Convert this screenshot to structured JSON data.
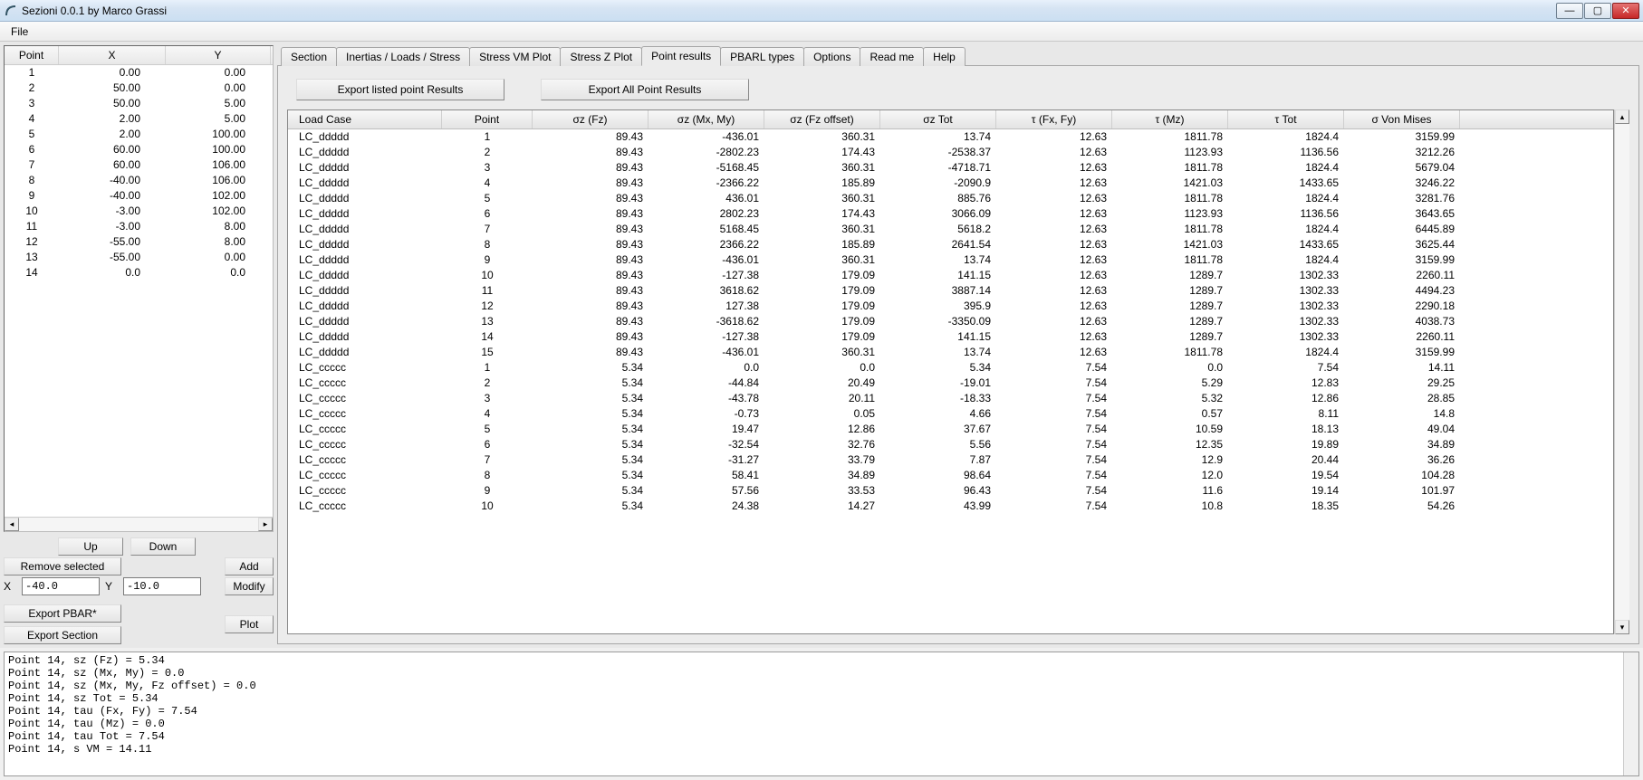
{
  "window": {
    "title": "Sezioni 0.0.1 by Marco Grassi",
    "menu": {
      "file": "File"
    }
  },
  "tabs": {
    "items": [
      "Section",
      "Inertias / Loads / Stress",
      "Stress VM Plot",
      "Stress Z Plot",
      "Point results",
      "PBARL types",
      "Options",
      "Read me",
      "Help"
    ],
    "active": 4
  },
  "left": {
    "headers": {
      "point": "Point",
      "x": "X",
      "y": "Y"
    },
    "rows": [
      {
        "p": "1",
        "x": "0.00",
        "y": "0.00"
      },
      {
        "p": "2",
        "x": "50.00",
        "y": "0.00"
      },
      {
        "p": "3",
        "x": "50.00",
        "y": "5.00"
      },
      {
        "p": "4",
        "x": "2.00",
        "y": "5.00"
      },
      {
        "p": "5",
        "x": "2.00",
        "y": "100.00"
      },
      {
        "p": "6",
        "x": "60.00",
        "y": "100.00"
      },
      {
        "p": "7",
        "x": "60.00",
        "y": "106.00"
      },
      {
        "p": "8",
        "x": "-40.00",
        "y": "106.00"
      },
      {
        "p": "9",
        "x": "-40.00",
        "y": "102.00"
      },
      {
        "p": "10",
        "x": "-3.00",
        "y": "102.00"
      },
      {
        "p": "11",
        "x": "-3.00",
        "y": "8.00"
      },
      {
        "p": "12",
        "x": "-55.00",
        "y": "8.00"
      },
      {
        "p": "13",
        "x": "-55.00",
        "y": "0.00"
      },
      {
        "p": "14",
        "x": "0.0",
        "y": "0.0"
      }
    ],
    "buttons": {
      "up": "Up",
      "down": "Down",
      "remove": "Remove selected",
      "add": "Add",
      "modify": "Modify",
      "pbar": "Export PBAR*",
      "section": "Export Section",
      "plot": "Plot"
    },
    "x_label": "X",
    "y_label": "Y",
    "x_value": "-40.0",
    "y_value": "-10.0"
  },
  "results": {
    "export_listed": "Export listed point Results",
    "export_all": "Export All Point Results",
    "headers": [
      "Load Case",
      "Point",
      "σz (Fz)",
      "σz (Mx, My)",
      "σz (Fz offset)",
      "σz Tot",
      "τ (Fx, Fy)",
      "τ (Mz)",
      "τ Tot",
      "σ Von Mises"
    ],
    "rows": [
      [
        "LC_ddddd",
        "1",
        "89.43",
        "-436.01",
        "360.31",
        "13.74",
        "12.63",
        "1811.78",
        "1824.4",
        "3159.99"
      ],
      [
        "LC_ddddd",
        "2",
        "89.43",
        "-2802.23",
        "174.43",
        "-2538.37",
        "12.63",
        "1123.93",
        "1136.56",
        "3212.26"
      ],
      [
        "LC_ddddd",
        "3",
        "89.43",
        "-5168.45",
        "360.31",
        "-4718.71",
        "12.63",
        "1811.78",
        "1824.4",
        "5679.04"
      ],
      [
        "LC_ddddd",
        "4",
        "89.43",
        "-2366.22",
        "185.89",
        "-2090.9",
        "12.63",
        "1421.03",
        "1433.65",
        "3246.22"
      ],
      [
        "LC_ddddd",
        "5",
        "89.43",
        "436.01",
        "360.31",
        "885.76",
        "12.63",
        "1811.78",
        "1824.4",
        "3281.76"
      ],
      [
        "LC_ddddd",
        "6",
        "89.43",
        "2802.23",
        "174.43",
        "3066.09",
        "12.63",
        "1123.93",
        "1136.56",
        "3643.65"
      ],
      [
        "LC_ddddd",
        "7",
        "89.43",
        "5168.45",
        "360.31",
        "5618.2",
        "12.63",
        "1811.78",
        "1824.4",
        "6445.89"
      ],
      [
        "LC_ddddd",
        "8",
        "89.43",
        "2366.22",
        "185.89",
        "2641.54",
        "12.63",
        "1421.03",
        "1433.65",
        "3625.44"
      ],
      [
        "LC_ddddd",
        "9",
        "89.43",
        "-436.01",
        "360.31",
        "13.74",
        "12.63",
        "1811.78",
        "1824.4",
        "3159.99"
      ],
      [
        "LC_ddddd",
        "10",
        "89.43",
        "-127.38",
        "179.09",
        "141.15",
        "12.63",
        "1289.7",
        "1302.33",
        "2260.11"
      ],
      [
        "LC_ddddd",
        "11",
        "89.43",
        "3618.62",
        "179.09",
        "3887.14",
        "12.63",
        "1289.7",
        "1302.33",
        "4494.23"
      ],
      [
        "LC_ddddd",
        "12",
        "89.43",
        "127.38",
        "179.09",
        "395.9",
        "12.63",
        "1289.7",
        "1302.33",
        "2290.18"
      ],
      [
        "LC_ddddd",
        "13",
        "89.43",
        "-3618.62",
        "179.09",
        "-3350.09",
        "12.63",
        "1289.7",
        "1302.33",
        "4038.73"
      ],
      [
        "LC_ddddd",
        "14",
        "89.43",
        "-127.38",
        "179.09",
        "141.15",
        "12.63",
        "1289.7",
        "1302.33",
        "2260.11"
      ],
      [
        "LC_ddddd",
        "15",
        "89.43",
        "-436.01",
        "360.31",
        "13.74",
        "12.63",
        "1811.78",
        "1824.4",
        "3159.99"
      ],
      [
        "LC_ccccc",
        "1",
        "5.34",
        "0.0",
        "0.0",
        "5.34",
        "7.54",
        "0.0",
        "7.54",
        "14.11"
      ],
      [
        "LC_ccccc",
        "2",
        "5.34",
        "-44.84",
        "20.49",
        "-19.01",
        "7.54",
        "5.29",
        "12.83",
        "29.25"
      ],
      [
        "LC_ccccc",
        "3",
        "5.34",
        "-43.78",
        "20.11",
        "-18.33",
        "7.54",
        "5.32",
        "12.86",
        "28.85"
      ],
      [
        "LC_ccccc",
        "4",
        "5.34",
        "-0.73",
        "0.05",
        "4.66",
        "7.54",
        "0.57",
        "8.11",
        "14.8"
      ],
      [
        "LC_ccccc",
        "5",
        "5.34",
        "19.47",
        "12.86",
        "37.67",
        "7.54",
        "10.59",
        "18.13",
        "49.04"
      ],
      [
        "LC_ccccc",
        "6",
        "5.34",
        "-32.54",
        "32.76",
        "5.56",
        "7.54",
        "12.35",
        "19.89",
        "34.89"
      ],
      [
        "LC_ccccc",
        "7",
        "5.34",
        "-31.27",
        "33.79",
        "7.87",
        "7.54",
        "12.9",
        "20.44",
        "36.26"
      ],
      [
        "LC_ccccc",
        "8",
        "5.34",
        "58.41",
        "34.89",
        "98.64",
        "7.54",
        "12.0",
        "19.54",
        "104.28"
      ],
      [
        "LC_ccccc",
        "9",
        "5.34",
        "57.56",
        "33.53",
        "96.43",
        "7.54",
        "11.6",
        "19.14",
        "101.97"
      ],
      [
        "LC_ccccc",
        "10",
        "5.34",
        "24.38",
        "14.27",
        "43.99",
        "7.54",
        "10.8",
        "18.35",
        "54.26"
      ]
    ]
  },
  "log": "Point 14, sz (Fz) = 5.34\nPoint 14, sz (Mx, My) = 0.0\nPoint 14, sz (Mx, My, Fz offset) = 0.0\nPoint 14, sz Tot = 5.34\nPoint 14, tau (Fx, Fy) = 7.54\nPoint 14, tau (Mz) = 0.0\nPoint 14, tau Tot = 7.54\nPoint 14, s VM = 14.11"
}
